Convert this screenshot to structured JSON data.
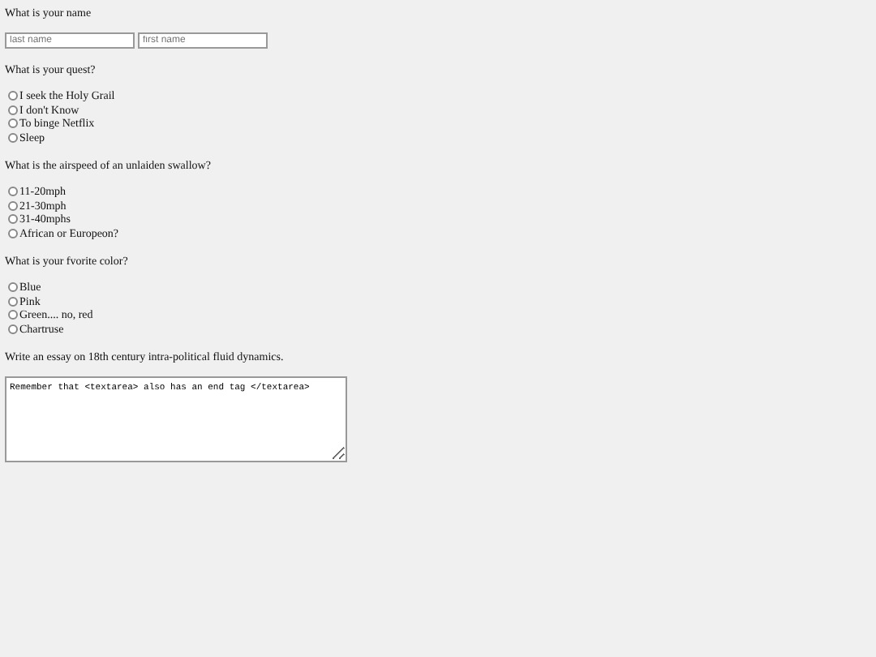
{
  "sections": [
    {
      "kind": "fields",
      "question": "What is your name",
      "fields": [
        {
          "placeholder": "last name"
        },
        {
          "placeholder": "first name"
        }
      ]
    },
    {
      "kind": "radios",
      "question": "What is your quest?",
      "options": [
        {
          "label": "I seek the Holy Grail",
          "selected": false
        },
        {
          "label": "I don't Know",
          "selected": false
        },
        {
          "label": "To binge Netflix",
          "selected": false
        },
        {
          "label": "Sleep",
          "selected": false
        }
      ]
    },
    {
      "kind": "radios",
      "question": "What is the airspeed of an unlaiden swallow?",
      "options": [
        {
          "label": "11-20mph",
          "selected": false
        },
        {
          "label": "21-30mph",
          "selected": false
        },
        {
          "label": "31-40mphs",
          "selected": false
        },
        {
          "label": "African or Europeon?",
          "selected": false
        }
      ]
    },
    {
      "kind": "radios",
      "question": "What is your fvorite color?",
      "options": [
        {
          "label": "Blue",
          "selected": false
        },
        {
          "label": "Pink",
          "selected": false
        },
        {
          "label": "Green.... no, red",
          "selected": false
        },
        {
          "label": "Chartruse",
          "selected": false
        }
      ]
    },
    {
      "kind": "textarea",
      "question": "Write an essay on 18th century intra-political fluid dynamics.",
      "value": "Remember that <textarea> also has an end tag </textarea>"
    }
  ]
}
